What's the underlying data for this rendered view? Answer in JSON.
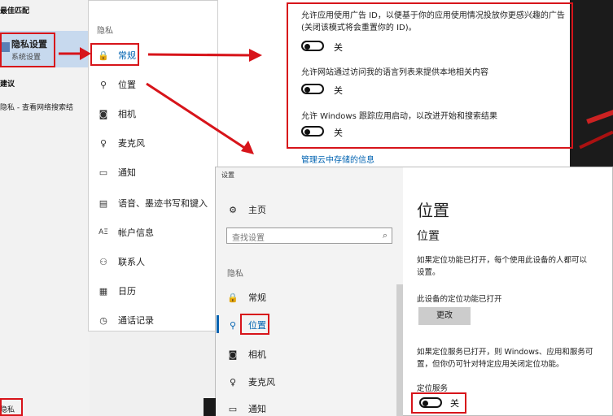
{
  "search_panel": {
    "best_match": "最佳匹配",
    "best_match_title": "隐私设置",
    "best_match_subtitle": "系统设置",
    "suggestions": "建议",
    "suggestion_item": "隐私 - 查看网络搜索结",
    "search_query": "隐私"
  },
  "privacy_nav": {
    "header": "隐私",
    "items": [
      {
        "label": "常规",
        "icon": "lock-icon"
      },
      {
        "label": "位置",
        "icon": "location-icon"
      },
      {
        "label": "相机",
        "icon": "camera-icon"
      },
      {
        "label": "麦克风",
        "icon": "microphone-icon"
      },
      {
        "label": "通知",
        "icon": "notification-icon"
      },
      {
        "label": "语音、墨迹书写和键入",
        "icon": "speech-icon"
      },
      {
        "label": "帐户信息",
        "icon": "account-icon"
      },
      {
        "label": "联系人",
        "icon": "contacts-icon"
      },
      {
        "label": "日历",
        "icon": "calendar-icon"
      },
      {
        "label": "通话记录",
        "icon": "call-history-icon"
      }
    ]
  },
  "general": {
    "setting1": "允许应用使用广告 ID，以便基于你的应用使用情况投放你更感兴趣的广告(关闭该模式将会重置你的 ID)。",
    "setting2": "允许网站通过访问我的语言列表来提供本地相关内容",
    "setting3": "允许 Windows 跟踪应用启动，以改进开始和搜索结果",
    "toggle_off": "关",
    "manage_link": "管理云中存储的信息"
  },
  "location_window": {
    "title": "设置",
    "home": "主页",
    "search_placeholder": "查找设置",
    "category": "隐私",
    "nav": [
      {
        "label": "常规",
        "icon": "lock-icon"
      },
      {
        "label": "位置",
        "icon": "location-icon"
      },
      {
        "label": "相机",
        "icon": "camera-icon"
      },
      {
        "label": "麦克风",
        "icon": "microphone-icon"
      },
      {
        "label": "通知",
        "icon": "notification-icon"
      }
    ],
    "page_title": "位置",
    "section_title": "位置",
    "desc1": "如果定位功能已打开，每个使用此设备的人都可以",
    "desc1b": "设置。",
    "device_status": "此设备的定位功能已打开",
    "change_button": "更改",
    "desc2": "如果定位服务已打开，则 Windows、应用和服务可",
    "desc2b": "置，但你仍可针对特定应用关闭定位功能。",
    "service_label": "定位服务",
    "service_state": "关"
  },
  "colors": {
    "highlight": "#d7141a",
    "accent": "#0063b1",
    "selection": "#c7d9ee"
  }
}
